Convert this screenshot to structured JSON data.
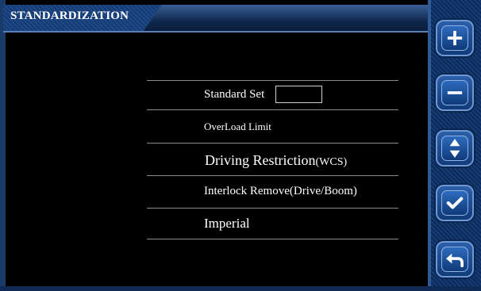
{
  "header": {
    "title": "STANDARDIZATION"
  },
  "menu": {
    "standard_set_label": "Standard Set",
    "standard_set_value": "",
    "overload_limit": "OverLoad Limit",
    "driving_restriction": "Driving Restriction",
    "driving_restriction_suffix": "(WCS)",
    "interlock_remove": "Interlock Remove(Drive/Boom)",
    "imperial": "Imperial"
  },
  "side_buttons": [
    {
      "icon": "plus-icon"
    },
    {
      "icon": "minus-icon"
    },
    {
      "icon": "up-down-arrows-icon"
    },
    {
      "icon": "checkmark-icon"
    },
    {
      "icon": "return-arrow-icon"
    }
  ],
  "colors": {
    "background": "#000000",
    "accent": "#1e4a8a",
    "text": "#ffffff",
    "separator": "#8a8a8a"
  }
}
